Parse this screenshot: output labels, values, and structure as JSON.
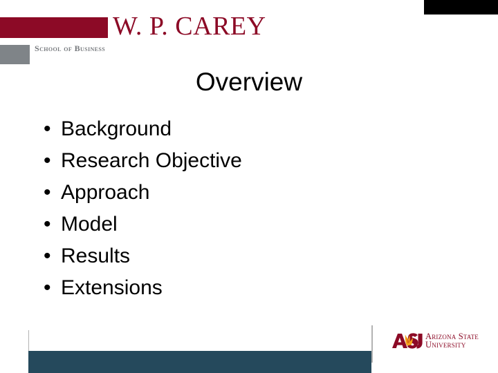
{
  "slide": {
    "title": "Overview",
    "background_color": "#ffffff"
  },
  "branding": {
    "wordmark": "W. P. CAREY",
    "subtitle": "School of Business",
    "maroon": "#8c0a26",
    "gray": "#7f8488",
    "black_corner_color": "#000000"
  },
  "content": {
    "bullet_marker": "•",
    "items": [
      {
        "label": "Background"
      },
      {
        "label": "Research Objective"
      },
      {
        "label": "Approach"
      },
      {
        "label": "Model"
      },
      {
        "label": "Results"
      },
      {
        "label": "Extensions"
      }
    ]
  },
  "footer": {
    "bar_color": "#25495c",
    "rule_color": "#b2b2b2",
    "logo": {
      "mark_text": "ASU",
      "line1": "Arizona State",
      "line2": "University",
      "maroon": "#8c0a26",
      "gold": "#f5a31a"
    }
  }
}
